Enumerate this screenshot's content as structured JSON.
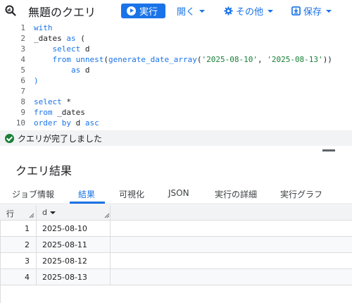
{
  "toolbar": {
    "title": "無題のクエリ",
    "run_label": "実行",
    "open_label": "開く",
    "other_label": "その他",
    "save_label": "保存"
  },
  "editor": {
    "lines": [
      {
        "num": "1",
        "parts": [
          [
            "k",
            "with"
          ]
        ]
      },
      {
        "num": "2",
        "parts": [
          [
            "p",
            "_dates "
          ],
          [
            "k",
            "as"
          ],
          [
            "p",
            " ("
          ]
        ]
      },
      {
        "num": "3",
        "parts": [
          [
            "p",
            "    "
          ],
          [
            "k",
            "select"
          ],
          [
            "p",
            " d"
          ]
        ]
      },
      {
        "num": "4",
        "parts": [
          [
            "p",
            "    "
          ],
          [
            "k",
            "from"
          ],
          [
            "p",
            " "
          ],
          [
            "f",
            "unnest"
          ],
          [
            "p",
            "("
          ],
          [
            "f",
            "generate_date_array"
          ],
          [
            "p",
            "("
          ],
          [
            "s",
            "'2025-08-10'"
          ],
          [
            "p",
            ", "
          ],
          [
            "s",
            "'2025-08-13'"
          ],
          [
            "p",
            "))"
          ]
        ]
      },
      {
        "num": "5",
        "parts": [
          [
            "p",
            "        "
          ],
          [
            "k",
            "as"
          ],
          [
            "p",
            " d"
          ]
        ]
      },
      {
        "num": "6",
        "parts": [
          [
            "k",
            ")"
          ]
        ]
      },
      {
        "num": "7",
        "parts": []
      },
      {
        "num": "8",
        "parts": [
          [
            "k",
            "select"
          ],
          [
            "p",
            " *"
          ]
        ]
      },
      {
        "num": "9",
        "parts": [
          [
            "k",
            "from"
          ],
          [
            "p",
            " _dates"
          ]
        ]
      },
      {
        "num": "10",
        "parts": [
          [
            "k",
            "order by"
          ],
          [
            "p",
            " d "
          ],
          [
            "k",
            "asc"
          ]
        ]
      }
    ]
  },
  "status": {
    "text": "クエリが完了しました",
    "color": "#188038"
  },
  "results": {
    "title": "クエリ結果",
    "tabs": [
      {
        "label": "ジョブ情報"
      },
      {
        "label": "結果"
      },
      {
        "label": "可視化"
      },
      {
        "label": "JSON"
      },
      {
        "label": "実行の詳細"
      },
      {
        "label": "実行グラフ"
      }
    ],
    "columns": {
      "row": "行",
      "d": "d"
    },
    "rows": [
      {
        "n": "1",
        "d": "2025-08-10"
      },
      {
        "n": "2",
        "d": "2025-08-11"
      },
      {
        "n": "3",
        "d": "2025-08-12"
      },
      {
        "n": "4",
        "d": "2025-08-13"
      }
    ]
  },
  "colors": {
    "accent": "#1a73e8",
    "success": "#188038"
  }
}
